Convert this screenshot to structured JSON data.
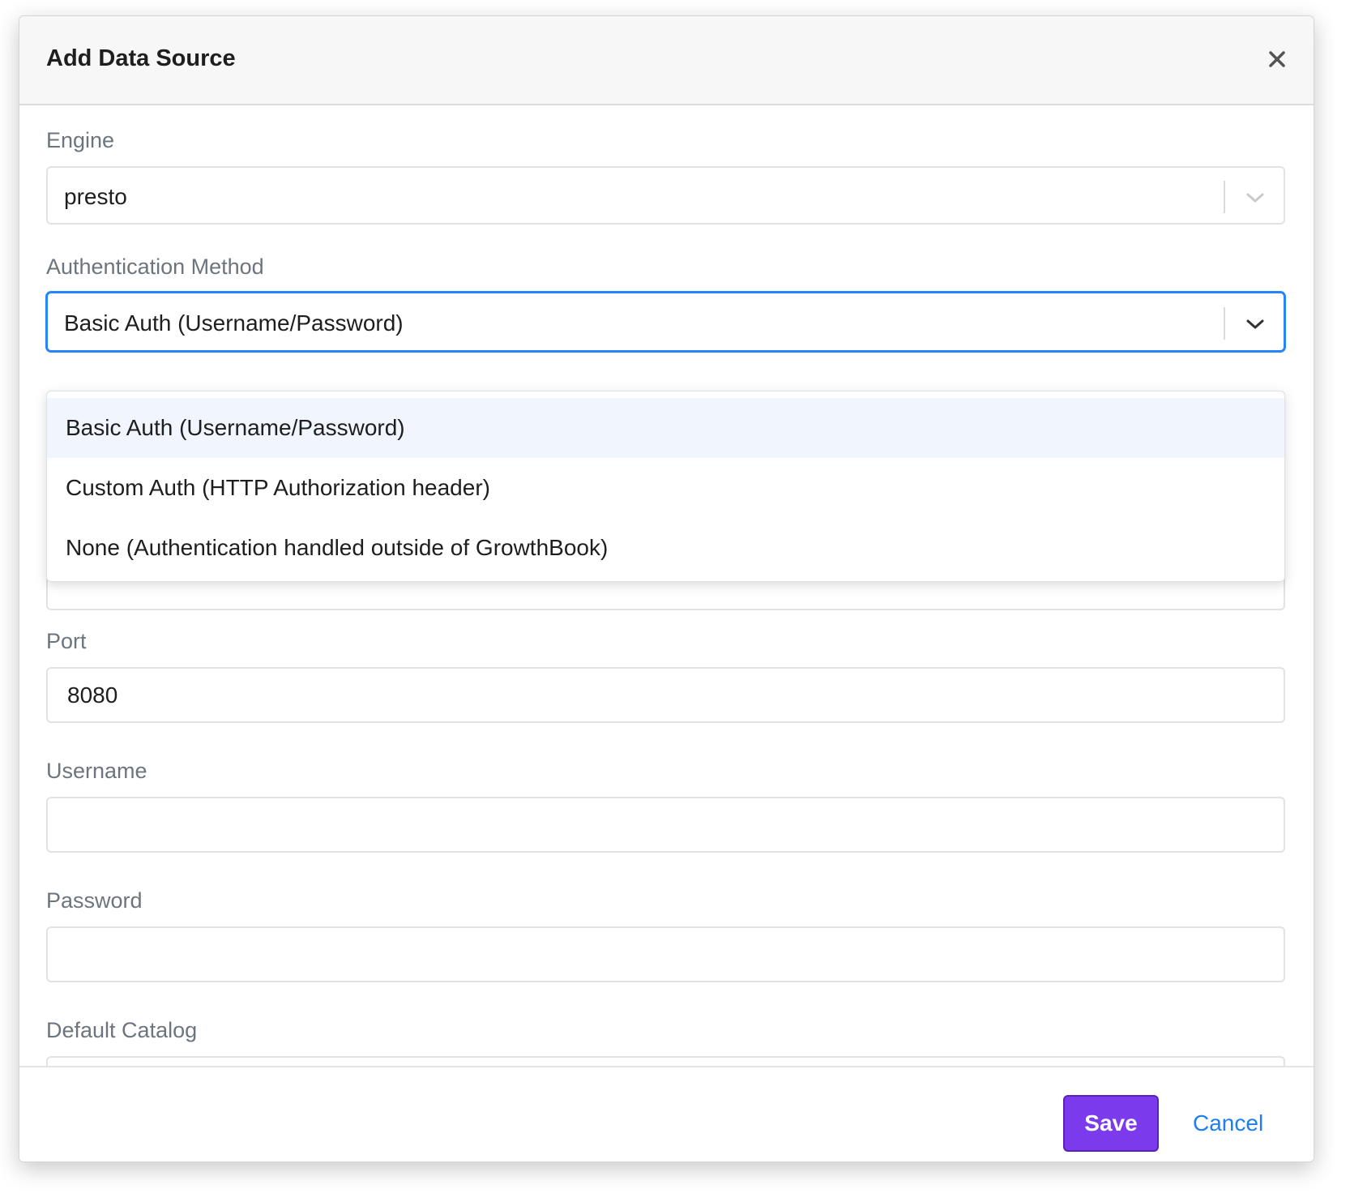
{
  "dialog": {
    "title": "Add Data Source"
  },
  "form": {
    "engine": {
      "label": "Engine",
      "value": "presto"
    },
    "auth_method": {
      "label": "Authentication Method",
      "value": "Basic Auth (Username/Password)",
      "options": [
        "Basic Auth (Username/Password)",
        "Custom Auth (HTTP Authorization header)",
        "None (Authentication handled outside of GrowthBook)"
      ],
      "highlighted_index": 0
    },
    "port": {
      "label": "Port",
      "value": "8080"
    },
    "username": {
      "label": "Username",
      "value": ""
    },
    "password": {
      "label": "Password",
      "value": ""
    },
    "default_catalog": {
      "label": "Default Catalog"
    }
  },
  "footer": {
    "save_label": "Save",
    "cancel_label": "Cancel"
  },
  "colors": {
    "primary_button": "#7c3aed",
    "link": "#1d7ff0",
    "focus_border": "#2684ff",
    "option_highlight": "#f0f5fe"
  },
  "icons": {
    "close": "close-icon",
    "dropdown": "chevron-down-icon"
  }
}
